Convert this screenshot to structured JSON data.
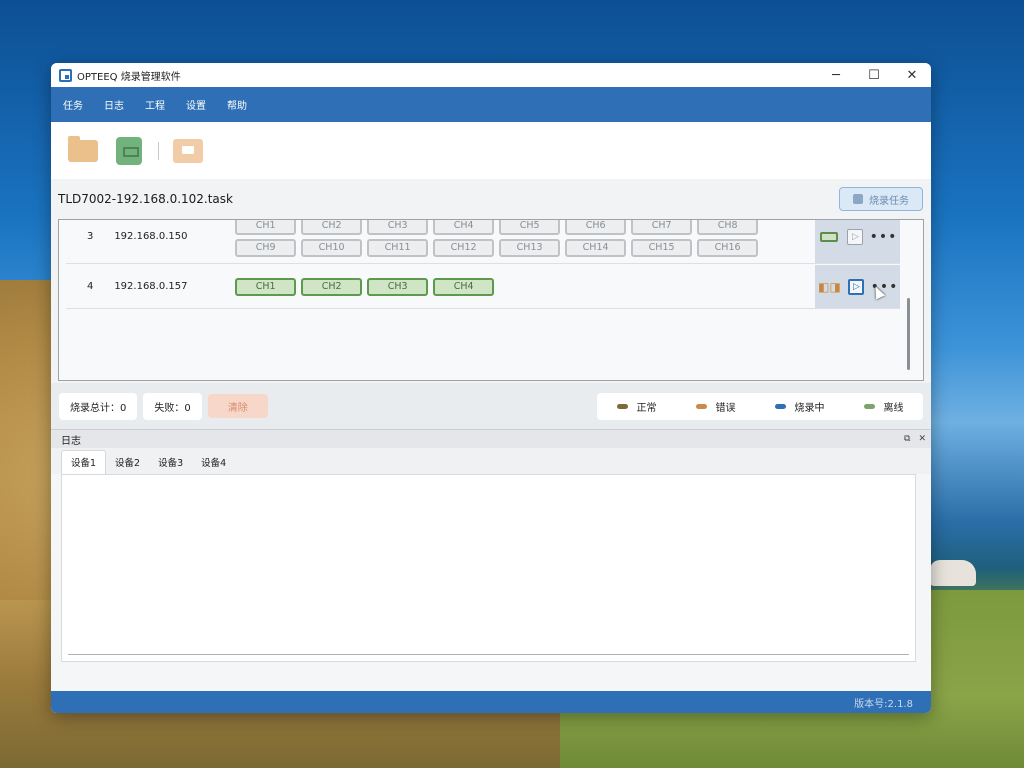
{
  "window": {
    "title": "OPTEEQ 烧录管理软件",
    "controls": [
      "─",
      "☐",
      "✕"
    ]
  },
  "menu": [
    "任务",
    "日志",
    "工程",
    "设置",
    "帮助"
  ],
  "toolbar": {
    "buttons": [
      "folder-open-icon",
      "chip-icon",
      "export-icon"
    ]
  },
  "task": {
    "name": "TLD7002-192.168.0.102.task",
    "button_label": "烧录任务"
  },
  "devices": [
    {
      "index": "3",
      "ip": "192.168.0.150",
      "channels": [
        "CH1",
        "CH2",
        "CH3",
        "CH4",
        "CH5",
        "CH6",
        "CH7",
        "CH8",
        "CH9",
        "CH10",
        "CH11",
        "CH12",
        "CH13",
        "CH14",
        "CH15",
        "CH16"
      ],
      "active": false
    },
    {
      "index": "4",
      "ip": "192.168.0.157",
      "channels": [
        "CH1",
        "CH2",
        "CH3",
        "CH4"
      ],
      "active": true
    }
  ],
  "status": {
    "total_label": "烧录总计：0",
    "fail_label": "失败：0",
    "clear_label": "清除"
  },
  "legend": [
    {
      "label": "正常",
      "color": "#7b6a3a"
    },
    {
      "label": "错误",
      "color": "#c98a4a"
    },
    {
      "label": "烧录中",
      "color": "#2f6fb6"
    },
    {
      "label": "离线",
      "color": "#7ea36b"
    }
  ],
  "log": {
    "title": "日志",
    "tabs": [
      "设备1",
      "设备2",
      "设备3",
      "设备4"
    ],
    "active_tab": 0
  },
  "footer": {
    "version": "版本号:2.1.8"
  }
}
